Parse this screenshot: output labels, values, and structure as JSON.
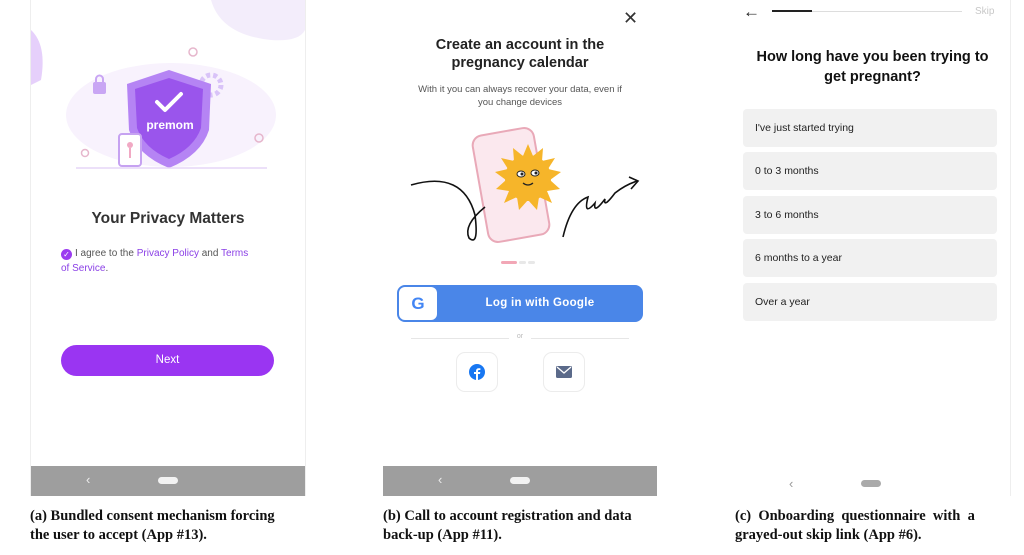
{
  "panel_a": {
    "logo_text": "premom",
    "title": "Your Privacy Matters",
    "consent_prefix": "I agree to the ",
    "privacy_policy": "Privacy Policy",
    "and": " and ",
    "terms_1": "Terms",
    "terms_2": "of Service",
    "period": ".",
    "next": "Next",
    "caption_1": "(a) Bundled consent mechanism forcing",
    "caption_2": "the user to accept (App #13)."
  },
  "panel_b": {
    "title_1": "Create an account in the",
    "title_2": "pregnancy calendar",
    "subtitle_1": "With it you can always recover your data, even if",
    "subtitle_2": "you change devices",
    "google_label": "Log in with Google",
    "or": "or",
    "caption_1": "(b) Call to account registration and data",
    "caption_2": "back-up (App #11)."
  },
  "panel_c": {
    "skip": "Skip",
    "progress": 0.21,
    "title_1": "How long have you been trying to",
    "title_2": "get pregnant?",
    "options": [
      "I've just started trying",
      "0 to 3 months",
      "3 to 6 months",
      "6 months to a year",
      "Over a year"
    ],
    "caption_1": "(c)  Onboarding  questionnaire  with  a",
    "caption_2": "grayed-out skip link (App #6)."
  },
  "nav": {
    "back": "‹"
  },
  "colors": {
    "purple": "#9a35f2",
    "google_blue": "#4a86e8",
    "option_bg": "#f1f1f1",
    "navbar": "#9e9e9e"
  },
  "icons": [
    "lock-icon",
    "shield-check-icon",
    "gear-icon",
    "phone-key-icon",
    "close-icon",
    "google-icon",
    "facebook-icon",
    "mail-icon",
    "arrow-left-icon"
  ]
}
